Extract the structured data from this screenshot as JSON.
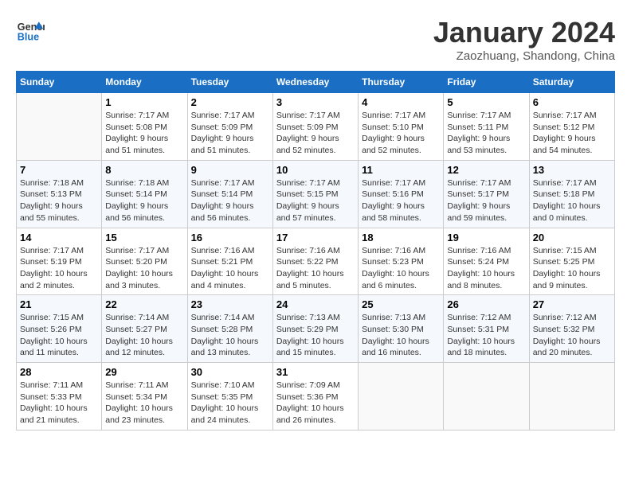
{
  "header": {
    "logo_general": "General",
    "logo_blue": "Blue",
    "month_title": "January 2024",
    "subtitle": "Zaozhuang, Shandong, China"
  },
  "days_of_week": [
    "Sunday",
    "Monday",
    "Tuesday",
    "Wednesday",
    "Thursday",
    "Friday",
    "Saturday"
  ],
  "weeks": [
    [
      {
        "day": "",
        "sunrise": "",
        "sunset": "",
        "daylight": ""
      },
      {
        "day": "1",
        "sunrise": "Sunrise: 7:17 AM",
        "sunset": "Sunset: 5:08 PM",
        "daylight": "Daylight: 9 hours and 51 minutes."
      },
      {
        "day": "2",
        "sunrise": "Sunrise: 7:17 AM",
        "sunset": "Sunset: 5:09 PM",
        "daylight": "Daylight: 9 hours and 51 minutes."
      },
      {
        "day": "3",
        "sunrise": "Sunrise: 7:17 AM",
        "sunset": "Sunset: 5:09 PM",
        "daylight": "Daylight: 9 hours and 52 minutes."
      },
      {
        "day": "4",
        "sunrise": "Sunrise: 7:17 AM",
        "sunset": "Sunset: 5:10 PM",
        "daylight": "Daylight: 9 hours and 52 minutes."
      },
      {
        "day": "5",
        "sunrise": "Sunrise: 7:17 AM",
        "sunset": "Sunset: 5:11 PM",
        "daylight": "Daylight: 9 hours and 53 minutes."
      },
      {
        "day": "6",
        "sunrise": "Sunrise: 7:17 AM",
        "sunset": "Sunset: 5:12 PM",
        "daylight": "Daylight: 9 hours and 54 minutes."
      }
    ],
    [
      {
        "day": "7",
        "sunrise": "Sunrise: 7:18 AM",
        "sunset": "Sunset: 5:13 PM",
        "daylight": "Daylight: 9 hours and 55 minutes."
      },
      {
        "day": "8",
        "sunrise": "Sunrise: 7:18 AM",
        "sunset": "Sunset: 5:14 PM",
        "daylight": "Daylight: 9 hours and 56 minutes."
      },
      {
        "day": "9",
        "sunrise": "Sunrise: 7:17 AM",
        "sunset": "Sunset: 5:14 PM",
        "daylight": "Daylight: 9 hours and 56 minutes."
      },
      {
        "day": "10",
        "sunrise": "Sunrise: 7:17 AM",
        "sunset": "Sunset: 5:15 PM",
        "daylight": "Daylight: 9 hours and 57 minutes."
      },
      {
        "day": "11",
        "sunrise": "Sunrise: 7:17 AM",
        "sunset": "Sunset: 5:16 PM",
        "daylight": "Daylight: 9 hours and 58 minutes."
      },
      {
        "day": "12",
        "sunrise": "Sunrise: 7:17 AM",
        "sunset": "Sunset: 5:17 PM",
        "daylight": "Daylight: 9 hours and 59 minutes."
      },
      {
        "day": "13",
        "sunrise": "Sunrise: 7:17 AM",
        "sunset": "Sunset: 5:18 PM",
        "daylight": "Daylight: 10 hours and 0 minutes."
      }
    ],
    [
      {
        "day": "14",
        "sunrise": "Sunrise: 7:17 AM",
        "sunset": "Sunset: 5:19 PM",
        "daylight": "Daylight: 10 hours and 2 minutes."
      },
      {
        "day": "15",
        "sunrise": "Sunrise: 7:17 AM",
        "sunset": "Sunset: 5:20 PM",
        "daylight": "Daylight: 10 hours and 3 minutes."
      },
      {
        "day": "16",
        "sunrise": "Sunrise: 7:16 AM",
        "sunset": "Sunset: 5:21 PM",
        "daylight": "Daylight: 10 hours and 4 minutes."
      },
      {
        "day": "17",
        "sunrise": "Sunrise: 7:16 AM",
        "sunset": "Sunset: 5:22 PM",
        "daylight": "Daylight: 10 hours and 5 minutes."
      },
      {
        "day": "18",
        "sunrise": "Sunrise: 7:16 AM",
        "sunset": "Sunset: 5:23 PM",
        "daylight": "Daylight: 10 hours and 6 minutes."
      },
      {
        "day": "19",
        "sunrise": "Sunrise: 7:16 AM",
        "sunset": "Sunset: 5:24 PM",
        "daylight": "Daylight: 10 hours and 8 minutes."
      },
      {
        "day": "20",
        "sunrise": "Sunrise: 7:15 AM",
        "sunset": "Sunset: 5:25 PM",
        "daylight": "Daylight: 10 hours and 9 minutes."
      }
    ],
    [
      {
        "day": "21",
        "sunrise": "Sunrise: 7:15 AM",
        "sunset": "Sunset: 5:26 PM",
        "daylight": "Daylight: 10 hours and 11 minutes."
      },
      {
        "day": "22",
        "sunrise": "Sunrise: 7:14 AM",
        "sunset": "Sunset: 5:27 PM",
        "daylight": "Daylight: 10 hours and 12 minutes."
      },
      {
        "day": "23",
        "sunrise": "Sunrise: 7:14 AM",
        "sunset": "Sunset: 5:28 PM",
        "daylight": "Daylight: 10 hours and 13 minutes."
      },
      {
        "day": "24",
        "sunrise": "Sunrise: 7:13 AM",
        "sunset": "Sunset: 5:29 PM",
        "daylight": "Daylight: 10 hours and 15 minutes."
      },
      {
        "day": "25",
        "sunrise": "Sunrise: 7:13 AM",
        "sunset": "Sunset: 5:30 PM",
        "daylight": "Daylight: 10 hours and 16 minutes."
      },
      {
        "day": "26",
        "sunrise": "Sunrise: 7:12 AM",
        "sunset": "Sunset: 5:31 PM",
        "daylight": "Daylight: 10 hours and 18 minutes."
      },
      {
        "day": "27",
        "sunrise": "Sunrise: 7:12 AM",
        "sunset": "Sunset: 5:32 PM",
        "daylight": "Daylight: 10 hours and 20 minutes."
      }
    ],
    [
      {
        "day": "28",
        "sunrise": "Sunrise: 7:11 AM",
        "sunset": "Sunset: 5:33 PM",
        "daylight": "Daylight: 10 hours and 21 minutes."
      },
      {
        "day": "29",
        "sunrise": "Sunrise: 7:11 AM",
        "sunset": "Sunset: 5:34 PM",
        "daylight": "Daylight: 10 hours and 23 minutes."
      },
      {
        "day": "30",
        "sunrise": "Sunrise: 7:10 AM",
        "sunset": "Sunset: 5:35 PM",
        "daylight": "Daylight: 10 hours and 24 minutes."
      },
      {
        "day": "31",
        "sunrise": "Sunrise: 7:09 AM",
        "sunset": "Sunset: 5:36 PM",
        "daylight": "Daylight: 10 hours and 26 minutes."
      },
      {
        "day": "",
        "sunrise": "",
        "sunset": "",
        "daylight": ""
      },
      {
        "day": "",
        "sunrise": "",
        "sunset": "",
        "daylight": ""
      },
      {
        "day": "",
        "sunrise": "",
        "sunset": "",
        "daylight": ""
      }
    ]
  ]
}
